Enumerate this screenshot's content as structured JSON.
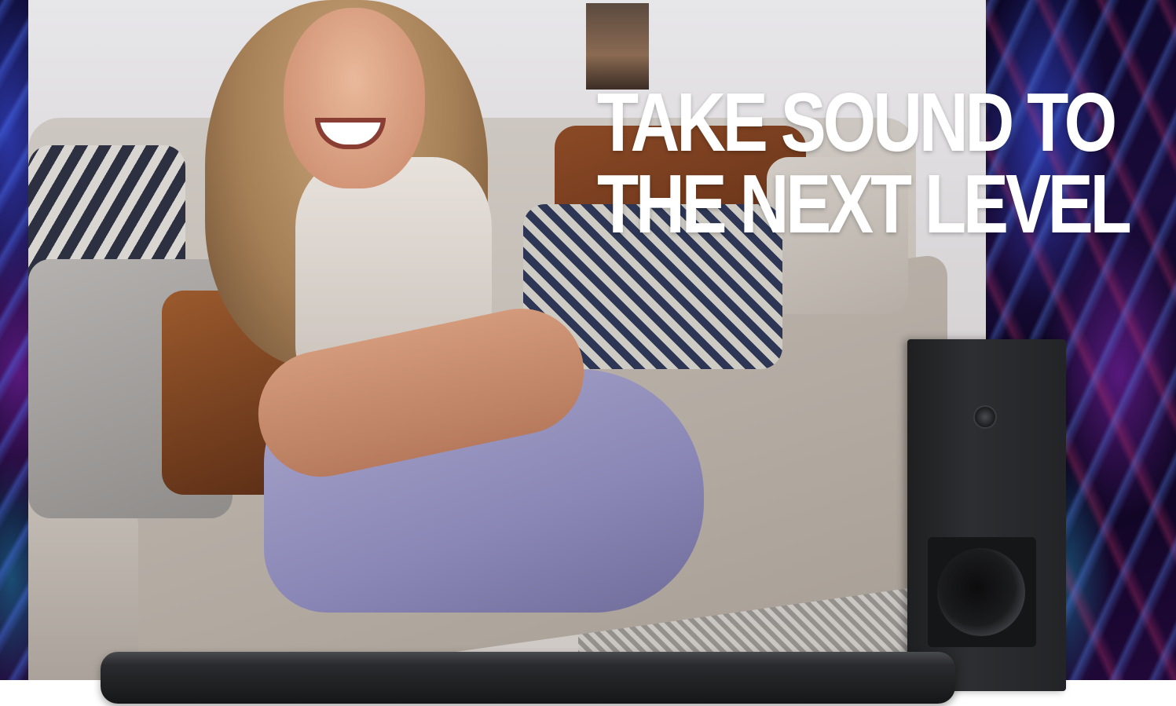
{
  "banner": {
    "headline_line1": "TAKE SOUND TO",
    "headline_line2": "THE NEXT LEVEL"
  },
  "colors": {
    "headline_text": "#ffffff",
    "background_swirl": "#0b0626",
    "product": "#1e1f21"
  }
}
